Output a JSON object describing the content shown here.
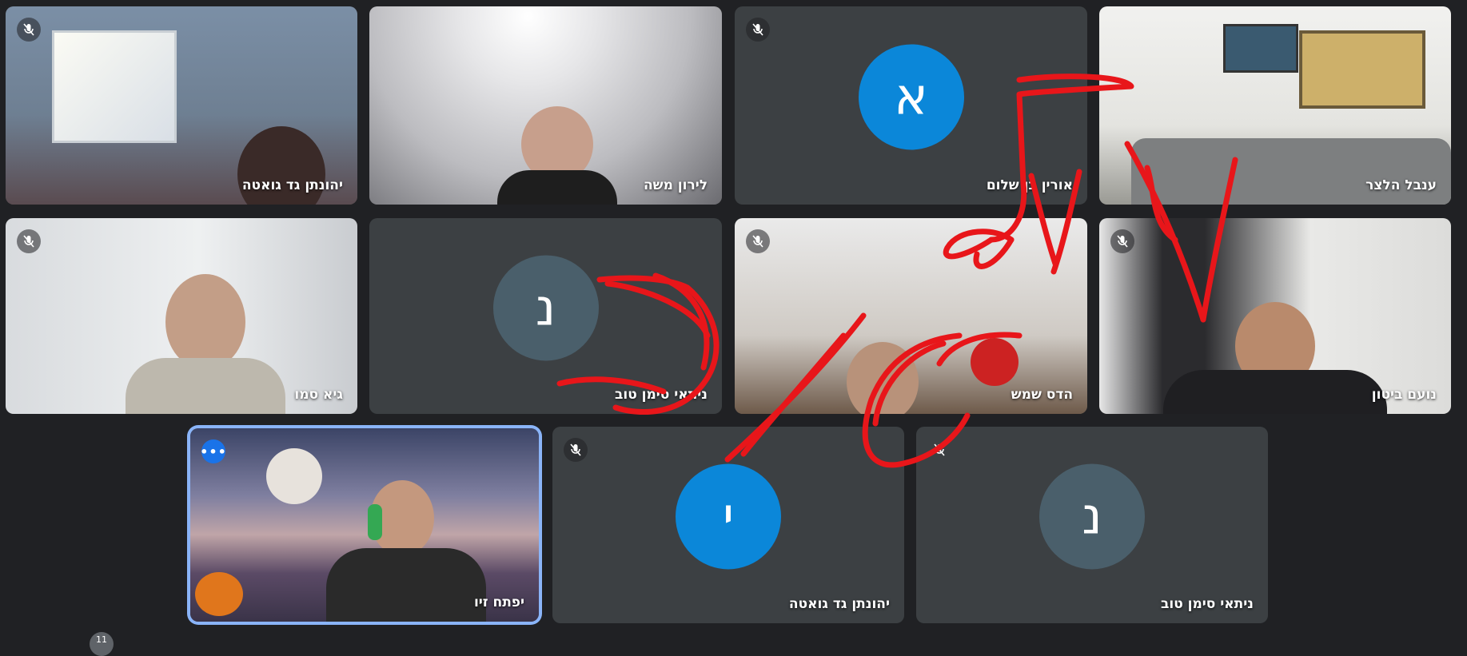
{
  "participants": [
    {
      "name": "יהונתן גד גואטה",
      "muted": true
    },
    {
      "name": "לירון משה",
      "muted": false
    },
    {
      "name": "אורין בן שלום",
      "muted": true,
      "avatar_letter": "א",
      "avatar_color": "#0b87d9"
    },
    {
      "name": "ענבל הלצר",
      "muted": false
    },
    {
      "name": "גיא סמו",
      "muted": true
    },
    {
      "name": "ניתאי סימן טוב",
      "muted": false,
      "avatar_letter": "נ",
      "avatar_color": "#4a5f6b"
    },
    {
      "name": "הדס שמש",
      "muted": true
    },
    {
      "name": "נועם ביטון",
      "muted": true
    },
    {
      "name": "יפתח זיו",
      "muted": false,
      "active": true
    },
    {
      "name": "יהונתן גד גואטה",
      "muted": true,
      "avatar_letter": "י",
      "avatar_color": "#0b87d9"
    },
    {
      "name": "ניתאי סימן טוב",
      "muted": true,
      "avatar_letter": "נ",
      "avatar_color": "#4a5f6b"
    }
  ],
  "icons": {
    "mute": "mic-off-icon",
    "more": "more-options-icon"
  },
  "more_label": "•••",
  "hidden_count": "11",
  "annotation_color": "#e8161a"
}
